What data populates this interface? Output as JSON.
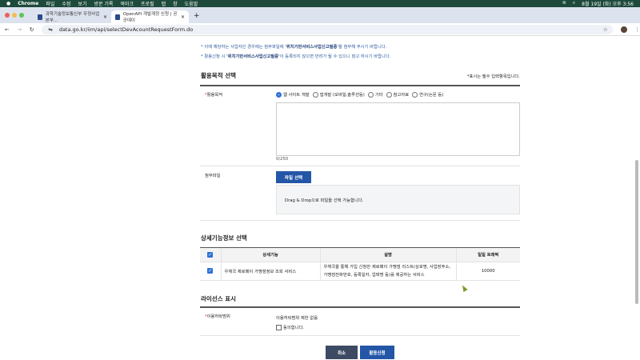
{
  "menubar": {
    "app": "Chrome",
    "items": [
      "파일",
      "수정",
      "보기",
      "방문 기록",
      "북마크",
      "프로필",
      "탭",
      "창",
      "도움말"
    ],
    "clock": "8월 19일 (화) 오후 3:56"
  },
  "tabs": [
    {
      "title": "과학기술정보통신부 우정사업본부..."
    },
    {
      "title": "OpenAPI 개발계정 신청 | 공공데이"
    }
  ],
  "address": {
    "url": "data.go.kr/iim/api/selectDevAcountRequestForm.do"
  },
  "notices": {
    "n1": "* 이에 해당하는 사업자인 경우에는 첨부파일에 ",
    "n1b": "'위치기반서비스사업신고필증'",
    "n1c": "을 첨부해 주시기 바랍니다.",
    "n2": "* 활용신청 시 ",
    "n2b": "'위치기반서비스사업신고필증'",
    "n2c": "이 등록되지 않으면 반려가 될 수 있으니 참고 하시기 바랍니다."
  },
  "purpose": {
    "title": "활용목적 선택",
    "required_note": "*표시는 필수 입력항목입니다.",
    "label": "활용목적",
    "options": [
      "웹 사이트 개발",
      "앱개발 (모바일,솔루션등)",
      "기타",
      "참고자료",
      "연구(논문 등)"
    ],
    "selected": 0,
    "textarea_value": "",
    "counter": "0/250"
  },
  "attachment": {
    "label": "첨부파일",
    "button": "파일 선택",
    "drop_text": "Drag & Drop으로 파일을 선택 가능합니다."
  },
  "detail": {
    "title": "상세기능정보 선택",
    "headers": [
      "상세기능",
      "설명",
      "일일 트래픽"
    ],
    "rows": [
      {
        "checked": true,
        "feature": "우체국 제로페이 가맹점정보 조회 서비스",
        "desc1": "우체국을 통해 가입 신청한 제로페이 가맹점 리스트(상호명, 사업장주소,",
        "desc2": "가맹점전화번호, 등록일자, 업태명 등)를 제공하는 서비스",
        "traffic": "10000"
      }
    ]
  },
  "license": {
    "title": "라이선스 표시",
    "label": "이용허락범위",
    "value": "이용허락범위 제한 없음",
    "agree": "동의합니다.",
    "agreed": false
  },
  "buttons": {
    "cancel": "취소",
    "apply": "활용신청"
  },
  "colors": {
    "primary": "#2456a8",
    "cancel": "#3d4a63",
    "notice": "#2c5aa0"
  }
}
